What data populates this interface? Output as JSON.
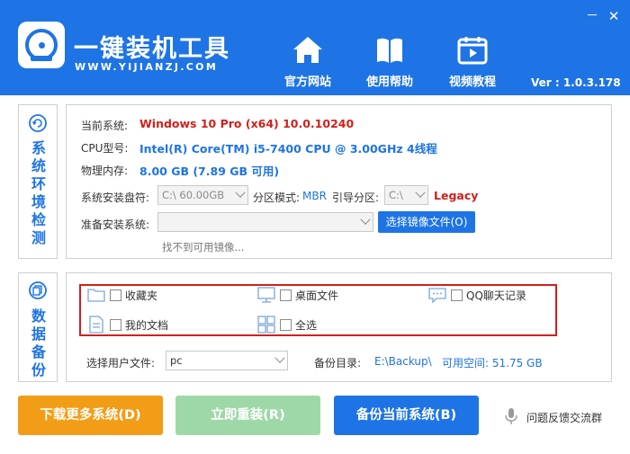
{
  "header": {
    "title": "一键装机工具",
    "subtitle": "WWW.YIJIANZJ.COM",
    "nav": [
      {
        "label": "官方网站",
        "icon": "home-icon"
      },
      {
        "label": "使用帮助",
        "icon": "book-icon"
      },
      {
        "label": "视频教程",
        "icon": "video-icon"
      }
    ],
    "version": "Ver : 1.0.3.178",
    "window_controls": {
      "minimize": "－",
      "close": "✕"
    }
  },
  "system": {
    "side_label": "系统环境检测",
    "current_os_label": "当前系统:",
    "current_os_value": "Windows 10 Pro (x64) 10.0.10240",
    "cpu_label": "CPU型号:",
    "cpu_value": "Intel(R) Core(TM) i5-7400 CPU @ 3.00GHz  4线程",
    "memory_label": "物理内存:",
    "memory_value": "8.00 GB (7.89 GB 可用)",
    "install_drive_label": "系统安装盘符:",
    "install_drive_value": "C:\\    60.00GB",
    "partition_mode_label": "分区模式:",
    "partition_mode_value": "MBR",
    "boot_partition_label": "引导分区:",
    "boot_partition_value": "C:\\",
    "boot_type": "Legacy",
    "prepare_label": "准备安装系统:",
    "prepare_value": "",
    "choose_image_button": "选择镜像文件(O)",
    "no_image_hint": "找不到可用镜像..."
  },
  "backup": {
    "side_label": "数据备份",
    "items": [
      {
        "label": "收藏夹",
        "icon": "folder-icon",
        "checked": false
      },
      {
        "label": "桌面文件",
        "icon": "monitor-icon",
        "checked": false
      },
      {
        "label": "QQ聊天记录",
        "icon": "chat-icon",
        "checked": false
      },
      {
        "label": "我的文档",
        "icon": "document-icon",
        "checked": false
      },
      {
        "label": "全选",
        "icon": "grid-icon",
        "checked": false
      }
    ],
    "user_file_label": "选择用户文件:",
    "user_file_value": "pc",
    "backup_dir_label": "备份目录:",
    "backup_dir_value": "E:\\Backup\\",
    "free_space_label": "可用空间: 51.75 GB"
  },
  "actions": {
    "download_more": "下载更多系统(D)",
    "reinstall_now": "立即重装(R)",
    "backup_current": "备份当前系统(B)",
    "feedback": "问题反馈交流群"
  },
  "colors": {
    "brand_blue": "#1e74e4",
    "warning_red": "#d0201b",
    "orange": "#f29d17",
    "green": "#9fd8a8"
  }
}
